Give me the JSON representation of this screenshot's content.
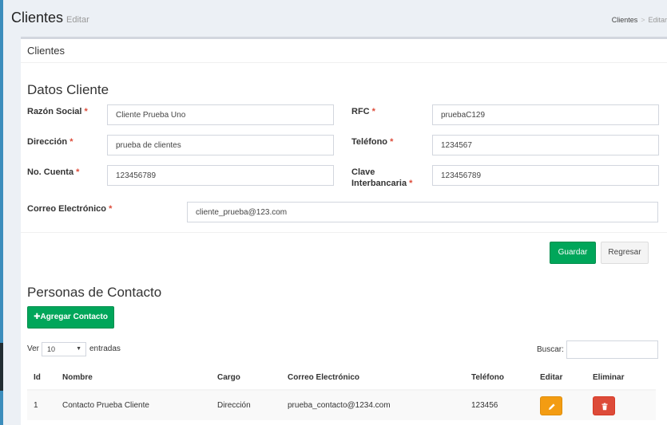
{
  "header": {
    "title": "Clientes",
    "subtitle": "Editar",
    "breadcrumb": [
      {
        "label": "Clientes"
      },
      {
        "label": "Editar"
      }
    ]
  },
  "box": {
    "title": "Clientes"
  },
  "cliente": {
    "section_title": "Datos Cliente",
    "required_mark": "*",
    "razon_social": {
      "label": "Razón Social",
      "value": "Cliente Prueba Uno"
    },
    "rfc": {
      "label": "RFC",
      "value": "pruebaC129"
    },
    "direccion": {
      "label": "Dirección",
      "value": "prueba de clientes"
    },
    "telefono": {
      "label": "Teléfono",
      "value": "1234567"
    },
    "no_cuenta": {
      "label": "No. Cuenta",
      "value": "123456789"
    },
    "clabe_line1": "Clave",
    "clabe_line2": "Interbancaria",
    "clabe_value": "123456789",
    "correo": {
      "label": "Correo Electrónico",
      "value": "cliente_prueba@123.com"
    }
  },
  "actions": {
    "save": "Guardar",
    "back": "Regresar"
  },
  "contactos": {
    "section_title": "Personas de Contacto",
    "add_button": "Agregar Contacto",
    "length_prefix": "Ver",
    "length_value": "10",
    "length_suffix": "entradas",
    "search_label": "Buscar:",
    "columns": [
      "Id",
      "Nombre",
      "Cargo",
      "Correo Electrónico",
      "Teléfono",
      "Editar",
      "Eliminar"
    ],
    "rows": [
      {
        "id": "1",
        "nombre": "Contacto Prueba Cliente",
        "cargo": "Dirección",
        "correo": "prueba_contacto@1234.com",
        "telefono": "123456"
      }
    ]
  },
  "colors": {
    "primary": "#3c8dbc",
    "success": "#00a65a",
    "warning": "#f39c12",
    "danger": "#dd4b39",
    "required": "#dd4b39"
  },
  "icons": {
    "add": "plus-icon",
    "edit": "pencil-icon",
    "delete": "trash-icon",
    "dropdown": "caret-down-icon"
  }
}
